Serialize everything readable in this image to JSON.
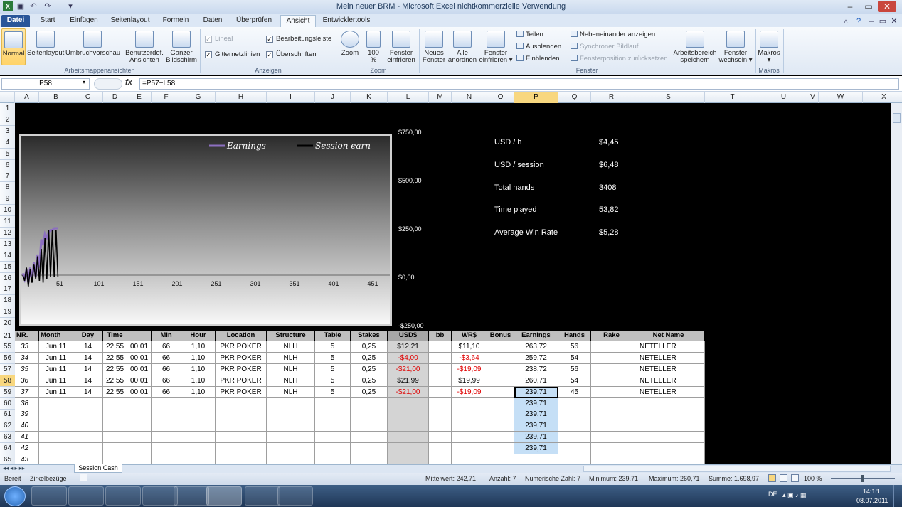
{
  "window": {
    "title": "Mein neuer BRM - Microsoft Excel nichtkommerzielle Verwendung"
  },
  "tabs": [
    "Datei",
    "Start",
    "Einfügen",
    "Seitenlayout",
    "Formeln",
    "Daten",
    "Überprüfen",
    "Ansicht",
    "Entwicklertools"
  ],
  "ribbon": {
    "arbeitsmappen": {
      "normal": "Normal",
      "seitenlayout": "Seitenlayout",
      "umbruch": "Umbruchvorschau",
      "benutzer1": "Benutzerdef.",
      "benutzer2": "Ansichten",
      "ganzer1": "Ganzer",
      "ganzer2": "Bildschirm",
      "label": "Arbeitsmappenansichten"
    },
    "anzeigen": {
      "lineal": "Lineal",
      "gitter": "Gitternetzlinien",
      "bearb": "Bearbeitungsleiste",
      "ueber": "Überschriften",
      "label": "Anzeigen"
    },
    "zoom": {
      "zoom": "Zoom",
      "p100a": "100",
      "p100b": "%",
      "sel1": "Fenster",
      "sel2": "einfrieren",
      "label": "Zoom"
    },
    "fenster": {
      "neu1": "Neues",
      "neu2": "Fenster",
      "alle1": "Alle",
      "alle2": "anordnen",
      "einf1": "Fenster",
      "einf2": "einfrieren",
      "teilen": "Teilen",
      "ausblenden": "Ausblenden",
      "einblenden": "Einblenden",
      "neben": "Nebeneinander anzeigen",
      "sync": "Synchroner Bildlauf",
      "pos": "Fensterposition zurücksetzen",
      "arb1": "Arbeitsbereich",
      "arb2": "speichern",
      "wech1": "Fenster",
      "wech2": "wechseln",
      "label": "Fenster"
    },
    "makros": {
      "m": "Makros",
      "label": "Makros"
    }
  },
  "formula_bar": {
    "name_box": "P58",
    "fx": "fx",
    "formula": "=P57+L58"
  },
  "columns": [
    "A",
    "B",
    "C",
    "D",
    "E",
    "F",
    "G",
    "H",
    "I",
    "J",
    "K",
    "L",
    "M",
    "N",
    "O",
    "P",
    "Q",
    "R",
    "S",
    "T",
    "U",
    "V",
    "W",
    "X"
  ],
  "rows": [
    "1",
    "2",
    "3",
    "4",
    "5",
    "6",
    "7",
    "8",
    "9",
    "10",
    "11",
    "12",
    "13",
    "14",
    "15",
    "16",
    "17",
    "18",
    "19",
    "20",
    "21",
    "55",
    "56",
    "57",
    "58",
    "59",
    "60",
    "61",
    "62",
    "63",
    "64",
    "65"
  ],
  "chart_data": {
    "type": "line",
    "legend": [
      "Earnings",
      "Session earn"
    ],
    "x_ticks": [
      "51",
      "101",
      "151",
      "201",
      "251",
      "301",
      "351",
      "401",
      "451"
    ],
    "y_ticks": [
      "$750,00",
      "$500,00",
      "$250,00",
      "$0,00",
      "-$250,00"
    ],
    "ylim": [
      -250,
      750
    ],
    "series": [
      {
        "name": "Earnings",
        "color": "#8c6fc0",
        "values": [
          10,
          -20,
          30,
          -40,
          40,
          -30,
          70,
          -10,
          110,
          40,
          190,
          160,
          220,
          200,
          230,
          240,
          240,
          250,
          250,
          250
        ]
      },
      {
        "name": "Session earn",
        "color": "#000000",
        "values": [
          0,
          -30,
          40,
          -60,
          30,
          -40,
          60,
          -20,
          100,
          -30,
          140,
          -40,
          200,
          -20,
          240,
          -10,
          240,
          -10,
          240,
          -10
        ]
      }
    ]
  },
  "stats": [
    {
      "label": "USD / h",
      "value": "$4,45"
    },
    {
      "label": "USD / session",
      "value": "$6,48"
    },
    {
      "label": "Total hands",
      "value": "3408"
    },
    {
      "label": "Time played",
      "value": "53,82"
    },
    {
      "label": "Average Win Rate",
      "value": "$5,28"
    }
  ],
  "table": {
    "headers": [
      "NR.",
      "Month",
      "Day",
      "Time",
      "",
      "Min",
      "Hour",
      "Location",
      "Structure",
      "Table",
      "Stakes",
      "USD$",
      "bb",
      "WR$",
      "Bonus",
      "Earnings",
      "Hands",
      "Rake",
      "Net Name"
    ],
    "rows": [
      [
        "33",
        "Jun 11",
        "14",
        "22:55",
        "00:01",
        "66",
        "1,10",
        "PKR POKER",
        "NLH",
        "5",
        "0,25",
        "$12,21",
        "",
        "$11,10",
        "",
        "263,72",
        "56",
        "",
        "NETELLER"
      ],
      [
        "34",
        "Jun 11",
        "14",
        "22:55",
        "00:01",
        "66",
        "1,10",
        "PKR POKER",
        "NLH",
        "5",
        "0,25",
        "-$4,00",
        "",
        "-$3,64",
        "",
        "259,72",
        "54",
        "",
        "NETELLER"
      ],
      [
        "35",
        "Jun 11",
        "14",
        "22:55",
        "00:01",
        "66",
        "1,10",
        "PKR POKER",
        "NLH",
        "5",
        "0,25",
        "-$21,00",
        "",
        "-$19,09",
        "",
        "238,72",
        "56",
        "",
        "NETELLER"
      ],
      [
        "36",
        "Jun 11",
        "14",
        "22:55",
        "00:01",
        "66",
        "1,10",
        "PKR POKER",
        "NLH",
        "5",
        "0,25",
        "$21,99",
        "",
        "$19,99",
        "",
        "260,71",
        "54",
        "",
        "NETELLER"
      ],
      [
        "37",
        "Jun 11",
        "14",
        "22:55",
        "00:01",
        "66",
        "1,10",
        "PKR POKER",
        "NLH",
        "5",
        "0,25",
        "-$21,00",
        "",
        "-$19,09",
        "",
        "239,71",
        "45",
        "",
        "NETELLER"
      ],
      [
        "38",
        "",
        "",
        "",
        "",
        "",
        "",
        "",
        "",
        "",
        "",
        "",
        "",
        "",
        "",
        "239,71",
        "",
        "",
        ""
      ],
      [
        "39",
        "",
        "",
        "",
        "",
        "",
        "",
        "",
        "",
        "",
        "",
        "",
        "",
        "",
        "",
        "239,71",
        "",
        "",
        ""
      ],
      [
        "40",
        "",
        "",
        "",
        "",
        "",
        "",
        "",
        "",
        "",
        "",
        "",
        "",
        "",
        "",
        "239,71",
        "",
        "",
        ""
      ],
      [
        "41",
        "",
        "",
        "",
        "",
        "",
        "",
        "",
        "",
        "",
        "",
        "",
        "",
        "",
        "",
        "239,71",
        "",
        "",
        ""
      ],
      [
        "42",
        "",
        "",
        "",
        "",
        "",
        "",
        "",
        "",
        "",
        "",
        "",
        "",
        "",
        "",
        "239,71",
        "",
        "",
        ""
      ],
      [
        "43",
        "",
        "",
        "",
        "",
        "",
        "",
        "",
        "",
        "",
        "",
        "",
        "",
        "",
        "",
        "",
        "",
        "",
        ""
      ]
    ]
  },
  "sheet_tabs": {
    "active": "Session Cash"
  },
  "status": {
    "ready": "Bereit",
    "zirkel": "Zirkelbezüge",
    "avg": "Mittelwert: 242,71",
    "count": "Anzahl: 7",
    "numcount": "Numerische Zahl: 7",
    "min": "Minimum: 239,71",
    "max": "Maximum: 260,71",
    "sum": "Summe: 1.698,97",
    "zoom": "100 %"
  },
  "taskbar": {
    "lang": "DE",
    "time": "14:18",
    "date": "08.07.2011"
  }
}
